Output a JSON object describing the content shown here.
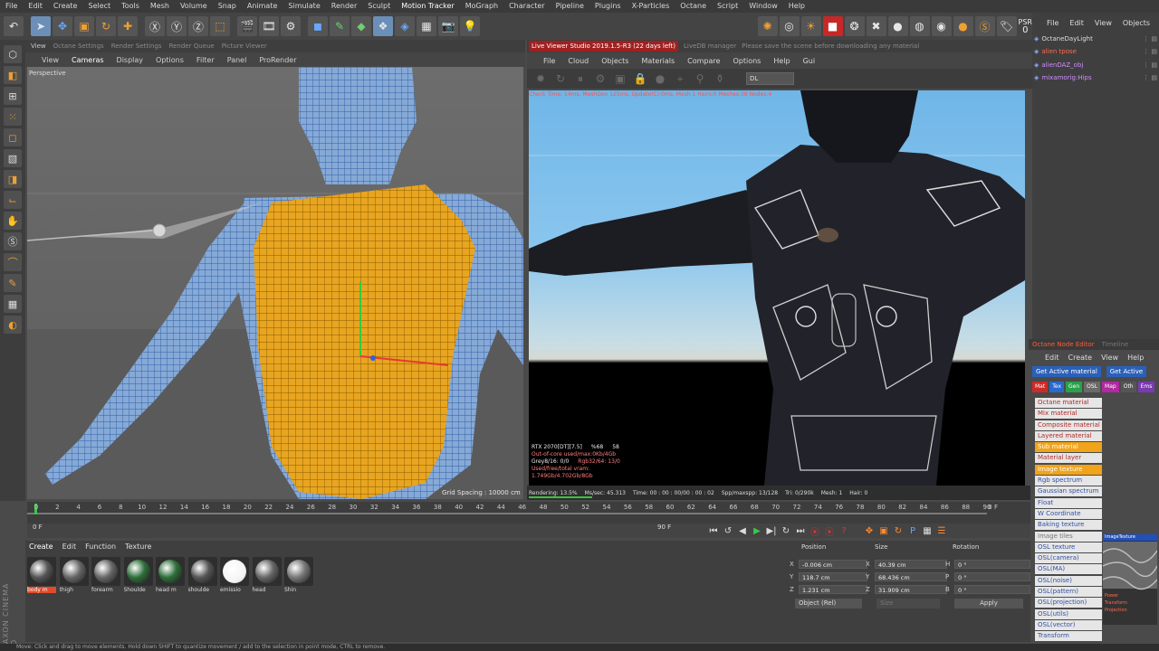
{
  "menubar": [
    "File",
    "Edit",
    "Create",
    "Select",
    "Tools",
    "Mesh",
    "Volume",
    "Snap",
    "Animate",
    "Simulate",
    "Render",
    "Sculpt",
    "Motion Tracker",
    "MoGraph",
    "Character",
    "Pipeline",
    "Plugins",
    "X-Particles",
    "Octane",
    "Script",
    "Window",
    "Help"
  ],
  "psr": {
    "label": "PSR",
    "value": "0"
  },
  "viewport": {
    "tabs": [
      "View",
      "Octane Settings",
      "Render Settings",
      "Render Queue",
      "Picture Viewer"
    ],
    "menu": [
      "View",
      "Cameras",
      "Display",
      "Options",
      "Filter",
      "Panel",
      "ProRender"
    ],
    "label": "Perspective",
    "grid": "Grid Spacing : 10000 cm"
  },
  "live_viewer": {
    "tab_active": "Live Viewer Studio 2019.1.5-R3 (22 days left)",
    "tab_other": "LiveDB manager",
    "tab_hint": "Please save the scene before downloading any material",
    "menu": [
      "File",
      "Cloud",
      "Objects",
      "Materials",
      "Compare",
      "Options",
      "Help",
      "Gui"
    ],
    "channel": "DL",
    "status": "Check Time: 14ms, MeshGen 125ms, Update(C):0ms, Mesh:1 Hairs:0 Meshes:38 Nodes:4",
    "gpu": [
      [
        "RTX 2070[DT][7.5]",
        "%68",
        "58"
      ],
      [
        "Out-of-core used/max:0Kb/4Gb",
        ""
      ],
      [
        "Grey8/16: 0/0",
        "Rgb32/64: 13/0"
      ],
      [
        "Used/free/total vram: 1.749Gb/4.702Gb/8Gb",
        ""
      ]
    ],
    "render_bar": [
      "Rendering: 13.5%",
      "Ms/sec: 45.313",
      "Time: 00 : 00 : 00/00 : 00 : 02",
      "Spp/maxspp: 13/128",
      "Tri: 0/290k",
      "Mesh: 1",
      "Hair: 0"
    ]
  },
  "objects": {
    "menu": [
      "File",
      "Edit",
      "View",
      "Objects",
      "Tag"
    ],
    "items": [
      {
        "name": "OctaneDayLight",
        "color": "#dddddd"
      },
      {
        "name": "alien tpose",
        "color": "#ff6a4a"
      },
      {
        "name": "alienDAZ_obj",
        "color": "#d08dff"
      },
      {
        "name": "mixamorig:Hips",
        "color": "#d08dff"
      }
    ]
  },
  "node_editor": {
    "title": "Octane Node Editor",
    "title2": "Timeline",
    "menu": [
      "Edit",
      "Create",
      "View",
      "Help"
    ],
    "btn1": "Get Active material",
    "btn2": "Get Active",
    "categories": [
      {
        "label": "Mat",
        "color": "#cc2a2a"
      },
      {
        "label": "Tex",
        "color": "#2a6acc"
      },
      {
        "label": "Gen",
        "color": "#2aa04a"
      },
      {
        "label": "OSL",
        "color": "#6a6a6a"
      },
      {
        "label": "Map",
        "color": "#b02aa0"
      },
      {
        "label": "Oth",
        "color": "#555555"
      },
      {
        "label": "Ems",
        "color": "#7a3ab0"
      }
    ],
    "nodes": [
      {
        "label": "Octane material",
        "cls": ""
      },
      {
        "label": "Mix material",
        "cls": ""
      },
      {
        "label": "Composite material",
        "cls": ""
      },
      {
        "label": "Layered material",
        "cls": ""
      },
      {
        "label": "Sub material",
        "cls": "sel"
      },
      {
        "label": "Material layer",
        "cls": ""
      },
      {
        "label": "Image texture",
        "cls": "sel"
      },
      {
        "label": "Rgb spectrum",
        "cls": "osl"
      },
      {
        "label": "Gaussian spectrum",
        "cls": "osl"
      },
      {
        "label": "Float",
        "cls": "osl"
      },
      {
        "label": "W Coordinate",
        "cls": "osl"
      },
      {
        "label": "Baking texture",
        "cls": "osl"
      },
      {
        "label": "Image tiles",
        "cls": "dim"
      },
      {
        "label": "OSL texture",
        "cls": "osl"
      },
      {
        "label": "OSL(camera)",
        "cls": "osl"
      },
      {
        "label": "OSL(MA)",
        "cls": "osl"
      },
      {
        "label": "OSL(noise)",
        "cls": "osl"
      },
      {
        "label": "OSL(pattern)",
        "cls": "osl"
      },
      {
        "label": "OSL(projection)",
        "cls": "osl"
      },
      {
        "label": "OSL(utils)",
        "cls": "osl"
      },
      {
        "label": "OSL(vector)",
        "cls": "osl"
      },
      {
        "label": "Transform",
        "cls": "osl"
      }
    ],
    "preview": {
      "title": "ImageTexture",
      "outputs": [
        "Power",
        "Transform",
        "Projection"
      ]
    }
  },
  "timeline": {
    "ticks": [
      "0",
      "2",
      "4",
      "6",
      "8",
      "10",
      "12",
      "14",
      "16",
      "18",
      "20",
      "22",
      "24",
      "26",
      "28",
      "30",
      "32",
      "34",
      "36",
      "38",
      "40",
      "42",
      "44",
      "46",
      "48",
      "50",
      "52",
      "54",
      "56",
      "58",
      "60",
      "62",
      "64",
      "66",
      "68",
      "70",
      "72",
      "74",
      "76",
      "78",
      "80",
      "82",
      "84",
      "86",
      "88",
      "90"
    ],
    "frame_end_label": "0 F",
    "current": "0 F",
    "range_end": "90 F"
  },
  "materials": {
    "menu": [
      "Create",
      "Edit",
      "Function",
      "Texture"
    ],
    "items": [
      {
        "label": "body m",
        "color": "#555",
        "sel": true
      },
      {
        "label": "thigh",
        "color": "#666",
        "sel": false
      },
      {
        "label": "forearm",
        "color": "#666",
        "sel": false
      },
      {
        "label": "Shoulde",
        "color": "#2f6e3a",
        "sel": false
      },
      {
        "label": "head m",
        "color": "#2f6e3a",
        "sel": false
      },
      {
        "label": "shoulde",
        "color": "#555",
        "sel": false
      },
      {
        "label": "emissio",
        "color": "#ffffff",
        "sel": false
      },
      {
        "label": "head",
        "color": "#666",
        "sel": false
      },
      {
        "label": "Shin",
        "color": "#777",
        "sel": false
      }
    ]
  },
  "maxon": "MAXON CINEMA 4D",
  "attributes": {
    "headers": [
      "Position",
      "Size",
      "Rotation"
    ],
    "rows": [
      {
        "a": "X",
        "pos": "-0.006 cm",
        "b": "X",
        "size": "40.39 cm",
        "c": "H",
        "rot": "0 °"
      },
      {
        "a": "Y",
        "pos": "118.7 cm",
        "b": "Y",
        "size": "68.436 cm",
        "c": "P",
        "rot": "0 °"
      },
      {
        "a": "Z",
        "pos": "1.231 cm",
        "b": "Z",
        "size": "31.909 cm",
        "c": "B",
        "rot": "0 °"
      }
    ],
    "coord": "Object (Rel)",
    "size_mode": "Size",
    "apply": "Apply"
  },
  "status": "Move: Click and drag to move elements. Hold down SHIFT to quantize movement / add to the selection in point mode, CTRL to remove."
}
